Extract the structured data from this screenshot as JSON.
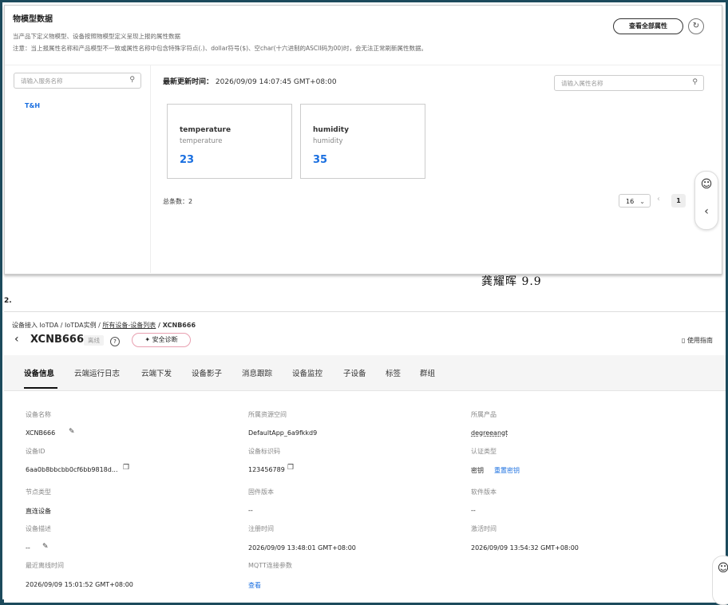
{
  "panel1": {
    "title": "物模型数据",
    "desc": "当产品下定义物模型、设备按照物模型定义呈现上报的属性数据",
    "note": "注意：当上报属性名称和产品模型不一致或属性名称中包含特殊字符点(.)、dollar符号($)、空char(十六进制的ASCII码为00)时，会无法正常刷新属性数据。",
    "view_all_button": "查看全部属性",
    "refresh_icon": "refresh-icon",
    "service_search_placeholder": "请输入服务名称",
    "service_item": "T&H",
    "last_update_label": "最新更新时间：",
    "last_update_value": "2026/09/09 14:07:45 GMT+08:00",
    "property_search_placeholder": "请输入属性名称",
    "cards": [
      {
        "name": "temperature",
        "sub": "temperature",
        "value": "23"
      },
      {
        "name": "humidity",
        "sub": "humidity",
        "value": "35"
      }
    ],
    "total_label": "总条数：2",
    "page_size": "16",
    "current_page": "1"
  },
  "signature": "龚耀晖 9.9",
  "section_number": "2.",
  "panel2": {
    "breadcrumb": {
      "part1": "设备接入 IoTDA / IoTDA实例 / ",
      "part2": "所有设备-设备列表",
      "part3": " / XCNB666"
    },
    "device_name": "XCNB666",
    "status_badge": "离线",
    "diagnose_button": "安全诊断",
    "guide_link": "使用指南",
    "tabs": [
      "设备信息",
      "云端运行日志",
      "云端下发",
      "设备影子",
      "消息跟踪",
      "设备监控",
      "子设备",
      "标签",
      "群组"
    ],
    "fields": {
      "device_name_label": "设备名称",
      "device_name_value": "XCNB666",
      "resource_space_label": "所属资源空间",
      "resource_space_value": "DefaultApp_6a9fkkd9",
      "product_label": "所属产品",
      "product_value": "degreeangt",
      "device_id_label": "设备ID",
      "device_id_value": "6aa0b8bbcbb0cf6bb9818d...",
      "node_id_label": "设备标识码",
      "node_id_value": "123456789",
      "auth_type_label": "认证类型",
      "auth_type_value": "密钥",
      "reset_key_link": "重置密钥",
      "node_type_label": "节点类型",
      "node_type_value": "直连设备",
      "firmware_label": "固件版本",
      "firmware_value": "--",
      "software_label": "软件版本",
      "software_value": "--",
      "desc_label": "设备描述",
      "desc_value": "--",
      "register_label": "注册时间",
      "register_value": "2026/09/09 13:48:01 GMT+08:00",
      "activate_label": "激活时间",
      "activate_value": "2026/09/09 13:54:32 GMT+08:00",
      "offline_label": "最近离线时间",
      "offline_value": "2026/09/09 15:01:52 GMT+08:00",
      "mqtt_label": "MQTT连接参数",
      "mqtt_link": "查看"
    }
  }
}
